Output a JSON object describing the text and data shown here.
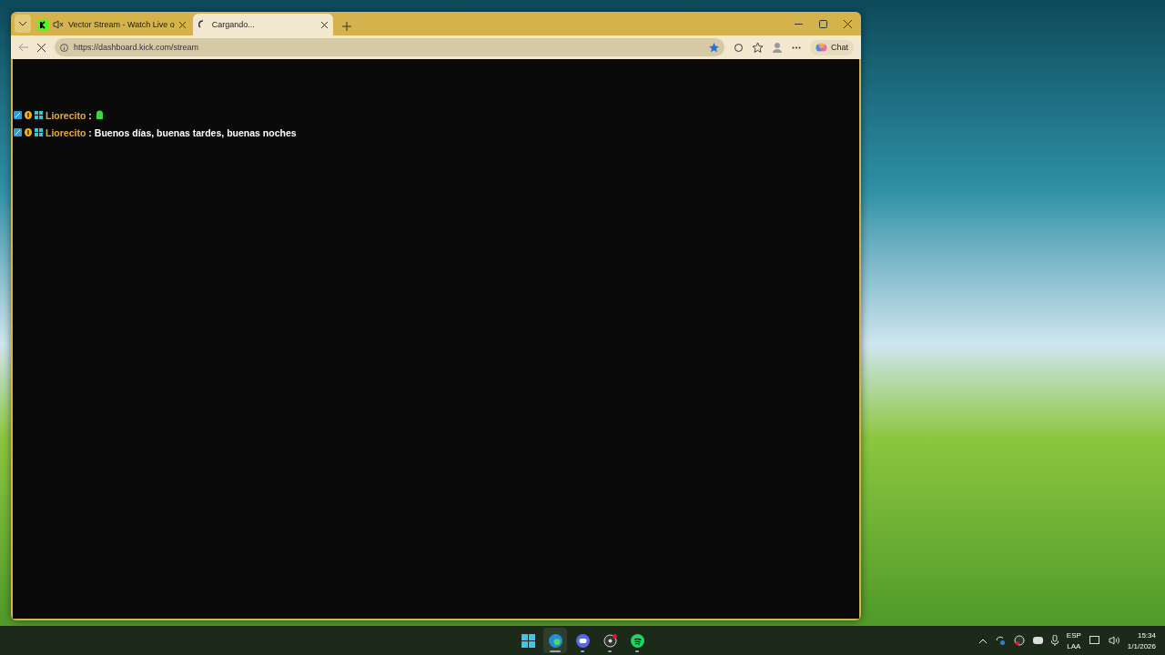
{
  "browser": {
    "tabs": [
      {
        "title": "Vector Stream - Watch Live o",
        "selected": false
      },
      {
        "title": "Cargando...",
        "selected": true
      }
    ],
    "address": "https://dashboard.kick.com/stream",
    "chat_button": "Chat"
  },
  "chat": {
    "messages": [
      {
        "user": "Liorecito",
        "separator": ":",
        "kind": "emote"
      },
      {
        "user": "Liorecito",
        "separator": ":",
        "kind": "text",
        "text": "Buenos días, buenas tardes, buenas noches"
      }
    ]
  },
  "taskbar": {
    "apps": [
      {
        "kind": "start",
        "selected": false
      },
      {
        "kind": "browser",
        "selected": true
      },
      {
        "kind": "chat",
        "selected": false
      },
      {
        "kind": "recorder",
        "selected": false
      },
      {
        "kind": "music",
        "selected": false
      }
    ],
    "language": "ESP",
    "layout": "LAA",
    "time": "15:34",
    "date": "1/1/2026"
  }
}
